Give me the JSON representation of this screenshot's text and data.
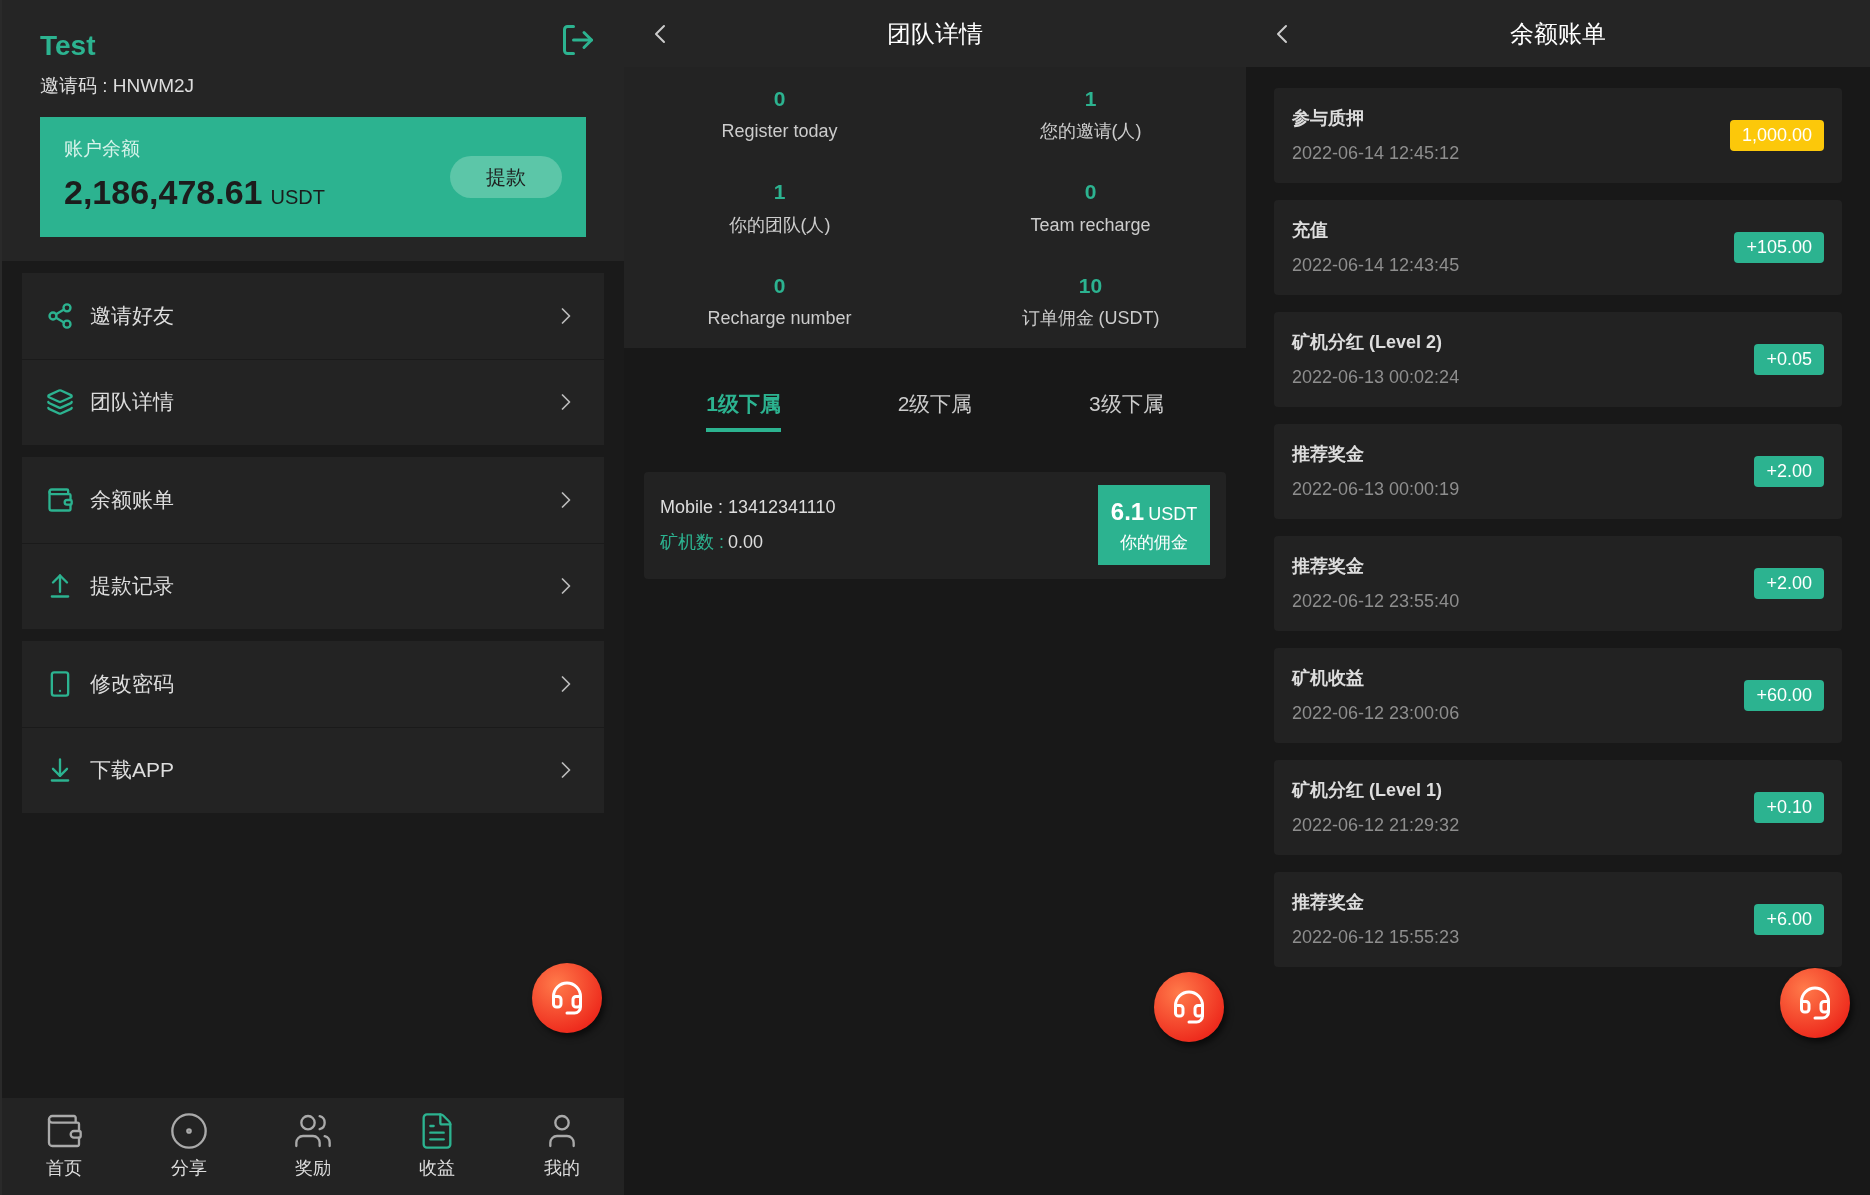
{
  "profile": {
    "name": "Test",
    "invite_code": "邀请码 : HNWM2J"
  },
  "balance": {
    "label": "账户余额",
    "amount": "2,186,478.61",
    "unit": "USDT",
    "button": "提款"
  },
  "menu_groups": [
    [
      {
        "label": "邀请好友"
      },
      {
        "label": "团队详情"
      }
    ],
    [
      {
        "label": "余额账单"
      },
      {
        "label": "提款记录"
      }
    ],
    [
      {
        "label": "修改密码"
      },
      {
        "label": "下载APP"
      }
    ]
  ],
  "bottom_nav": [
    {
      "label": "首页",
      "selected": false
    },
    {
      "label": "分享",
      "selected": false
    },
    {
      "label": "奖励",
      "selected": false
    },
    {
      "label": "收益",
      "selected": true
    },
    {
      "label": "我的",
      "selected": false
    }
  ],
  "team": {
    "title": "团队详情",
    "stats": [
      {
        "value": "0",
        "label": "Register today"
      },
      {
        "value": "1",
        "label": "您的邀请(人)"
      },
      {
        "value": "1",
        "label": "你的团队(人)"
      },
      {
        "value": "0",
        "label": "Team recharge"
      },
      {
        "value": "0",
        "label": "Recharge number"
      },
      {
        "value": "10",
        "label": "订单佣金 (USDT)"
      }
    ],
    "tabs": [
      {
        "label": "1级下属",
        "selected": true
      },
      {
        "label": "2级下属",
        "selected": false
      },
      {
        "label": "3级下属",
        "selected": false
      }
    ],
    "members": [
      {
        "mobile": "Mobile : 13412341110",
        "machines_label": "矿机数 :",
        "machines_value": "0.00",
        "commission": "6.1",
        "commission_unit": "USDT",
        "commission_label": "你的佣金"
      }
    ]
  },
  "bill": {
    "title": "余额账单",
    "entries": [
      {
        "title": "参与质押",
        "time": "2022-06-14 12:45:12",
        "amount": "1,000.00",
        "color": "#fcc80a"
      },
      {
        "title": "充值",
        "time": "2022-06-14 12:43:45",
        "amount": "+105.00",
        "color": "#2cb390"
      },
      {
        "title": "矿机分红 (Level 2)",
        "time": "2022-06-13 00:02:24",
        "amount": "+0.05",
        "color": "#2cb390"
      },
      {
        "title": "推荐奖金",
        "time": "2022-06-13 00:00:19",
        "amount": "+2.00",
        "color": "#2cb390"
      },
      {
        "title": "推荐奖金",
        "time": "2022-06-12 23:55:40",
        "amount": "+2.00",
        "color": "#2cb390"
      },
      {
        "title": "矿机收益",
        "time": "2022-06-12 23:00:06",
        "amount": "+60.00",
        "color": "#2cb390"
      },
      {
        "title": "矿机分红 (Level 1)",
        "time": "2022-06-12 21:29:32",
        "amount": "+0.10",
        "color": "#2cb390"
      },
      {
        "title": "推荐奖金",
        "time": "2022-06-12 15:55:23",
        "amount": "+6.00",
        "color": "#2cb390"
      }
    ]
  }
}
